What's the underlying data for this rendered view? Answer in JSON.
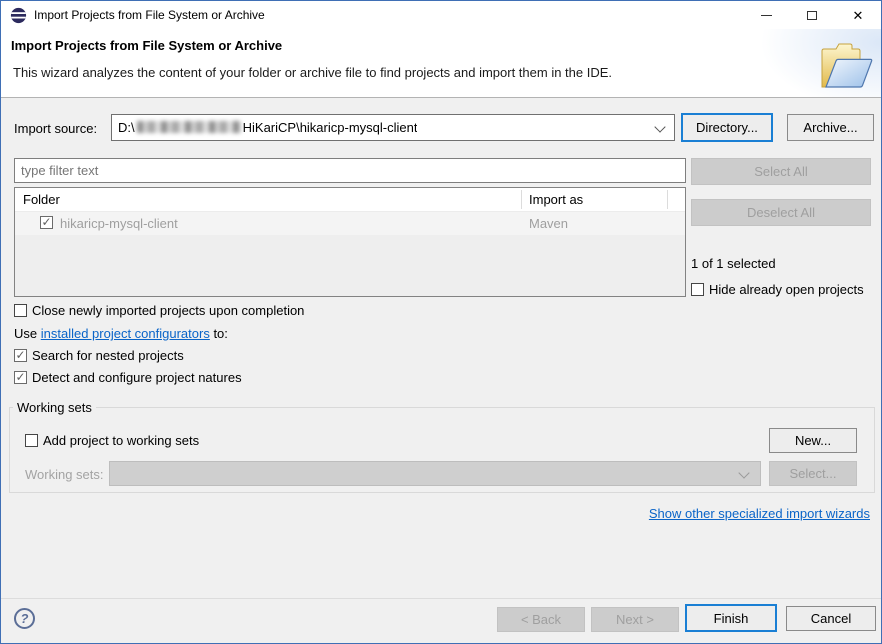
{
  "window": {
    "title": "Import Projects from File System or Archive",
    "close_glyph": "✕"
  },
  "header": {
    "title": "Import Projects from File System or Archive",
    "description": "This wizard analyzes the content of your folder or archive file to find projects and import them in the IDE."
  },
  "source": {
    "label": "Import source:",
    "path_prefix": "D:\\",
    "path_suffix": "HiKariCP\\hikaricp-mysql-client",
    "directory_button": "Directory...",
    "archive_button": "Archive..."
  },
  "filter": {
    "placeholder": "type filter text"
  },
  "table": {
    "col_folder": "Folder",
    "col_import_as": "Import as",
    "rows": [
      {
        "folder": "hikaricp-mysql-client",
        "import_as": "Maven",
        "checked": true
      }
    ]
  },
  "selection": {
    "select_all": "Select All",
    "deselect_all": "Deselect All",
    "status": "1 of 1 selected",
    "hide_open": "Hide already open projects"
  },
  "options": {
    "close_imported": "Close newly imported projects upon completion",
    "use_prefix": "Use ",
    "configurators_link": "installed project configurators",
    "use_suffix": " to:",
    "search_nested": "Search for nested projects",
    "detect_natures": "Detect and configure project natures"
  },
  "working_sets": {
    "title": "Working sets",
    "add_label": "Add project to working sets",
    "new_button": "New...",
    "label": "Working sets:",
    "select_button": "Select..."
  },
  "links": {
    "other_wizards": "Show other specialized import wizards"
  },
  "footer": {
    "help_glyph": "?",
    "back": "< Back",
    "next": "Next >",
    "finish": "Finish",
    "cancel": "Cancel"
  },
  "colors": {
    "accent": "#0078d7",
    "link": "#0a64c8",
    "dialog_bg": "#f0f0f0",
    "disabled_text": "#9f9f9f"
  }
}
